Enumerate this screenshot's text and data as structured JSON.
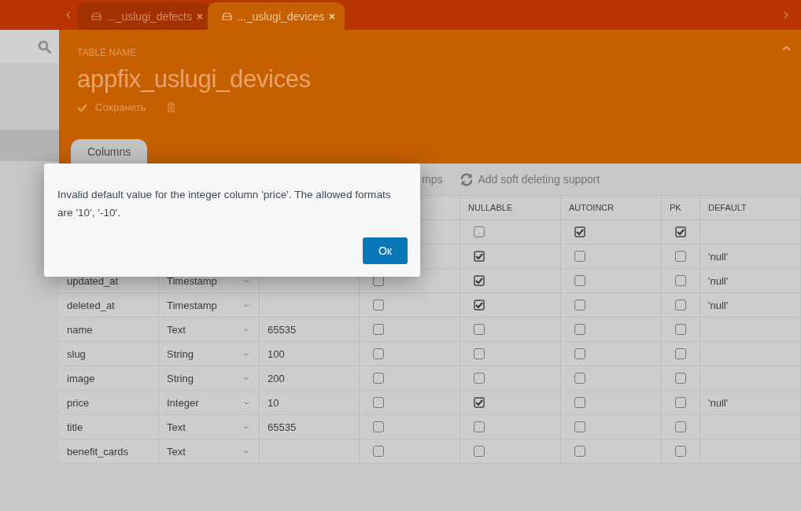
{
  "tabs": [
    {
      "label": "..._uslugi_defects",
      "selected": false
    },
    {
      "label": "..._uslugi_devices",
      "selected": true
    }
  ],
  "header": {
    "label": "TABLE NAME",
    "title": "appfix_uslugi_devices",
    "save": "Сохранить"
  },
  "section_tabs": [
    {
      "label": "Columns",
      "selected": true
    }
  ],
  "toolbar": [
    "mps",
    "Add soft deleting support"
  ],
  "table": {
    "columns": [
      "NULLABLE",
      "AUTOINCR",
      "PK",
      "DEFAULT"
    ],
    "rows": [
      {
        "nullable": false,
        "autoincr": true,
        "pk": true
      },
      {
        "nullable": true,
        "autoincr": false,
        "pk": false,
        "default": "'null'"
      },
      {
        "name": "updated_at",
        "type": "Timestamp",
        "flag": false,
        "nullable": true,
        "autoincr": false,
        "pk": false,
        "default": "'null'"
      },
      {
        "name": "deleted_at",
        "type": "Timestamp",
        "flag": false,
        "nullable": true,
        "autoincr": false,
        "pk": false,
        "default": "'null'"
      },
      {
        "name": "name",
        "type": "Text",
        "length": "65535",
        "flag": false,
        "nullable": false,
        "autoincr": false,
        "pk": false
      },
      {
        "name": "slug",
        "type": "String",
        "length": "100",
        "flag": false,
        "nullable": false,
        "autoincr": false,
        "pk": false
      },
      {
        "name": "image",
        "type": "String",
        "length": "200",
        "flag": false,
        "nullable": false,
        "autoincr": false,
        "pk": false
      },
      {
        "name": "price",
        "type": "Integer",
        "length": "10",
        "flag": false,
        "nullable": true,
        "autoincr": false,
        "pk": false,
        "default": "'null'"
      },
      {
        "name": "title",
        "type": "Text",
        "length": "65535",
        "flag": false,
        "nullable": false,
        "autoincr": false,
        "pk": false
      },
      {
        "name": "benefit_cards",
        "type": "Text",
        "flag": false,
        "nullable": false,
        "autoincr": false,
        "pk": false
      }
    ]
  },
  "dialog": {
    "message": "Invalid default value for the integer column 'price'. The allowed formats are '10', '-10'.",
    "button": "Ок"
  }
}
